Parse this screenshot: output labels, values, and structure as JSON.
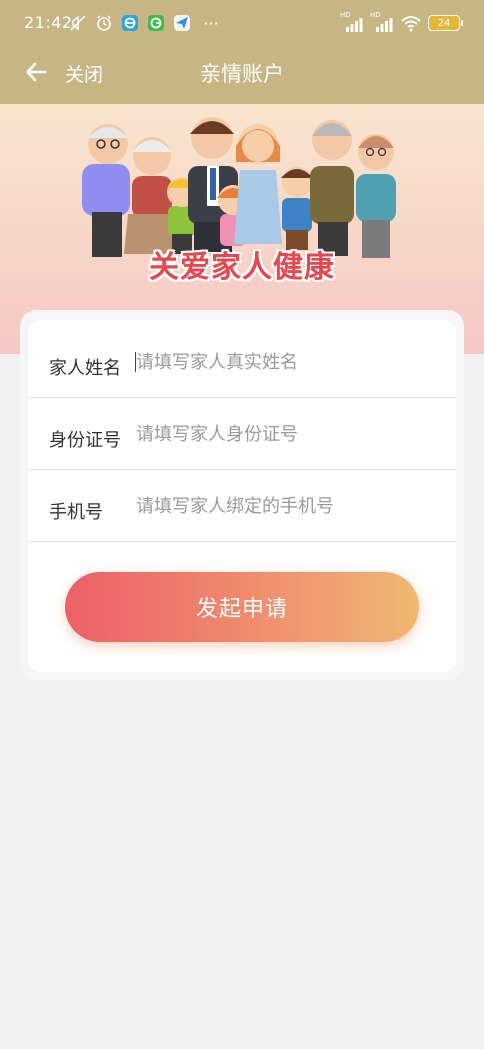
{
  "status_bar": {
    "time": "21:42",
    "battery": "24",
    "left_icons": [
      "mute-icon",
      "alarm-icon",
      "app-e-icon",
      "app-g-icon",
      "app-send-icon",
      "more-dots-icon"
    ],
    "right_icons": [
      "hd-signal-icon",
      "hd-signal-icon",
      "wifi-icon",
      "battery-icon"
    ],
    "more": "···",
    "hd": "HD"
  },
  "nav": {
    "close_label": "关闭",
    "title": "亲情账户"
  },
  "banner": {
    "slogan": "关爱家人健康"
  },
  "form": {
    "name_label": "家人姓名",
    "name_placeholder": "请填写家人真实姓名",
    "id_label": "身份证号",
    "id_placeholder": "请填写家人身份证号",
    "phone_label": "手机号",
    "phone_placeholder": "请填写家人绑定的手机号",
    "submit_label": "发起申请"
  },
  "colors": {
    "header_bg": "#c8b584",
    "button_gradient_start": "#ec6068",
    "button_gradient_end": "#efb873",
    "page_bg": "#f2f2f2"
  }
}
